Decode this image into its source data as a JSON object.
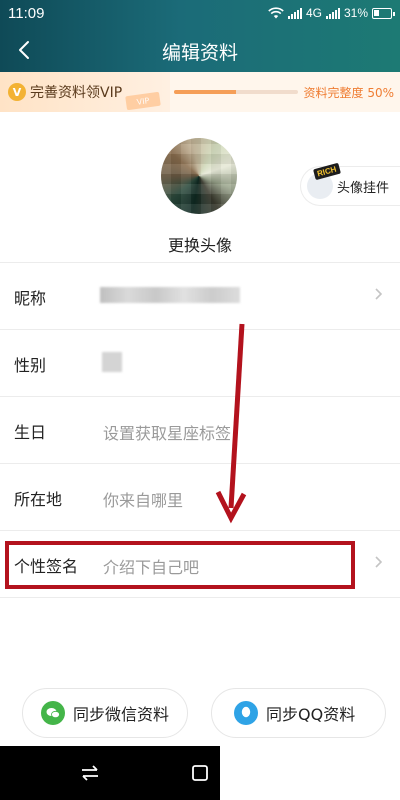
{
  "status_bar": {
    "time": "11:09",
    "network": "4G",
    "battery": "31%"
  },
  "header": {
    "title": "编辑资料",
    "back_icon": "chevron-left-icon"
  },
  "vip_banner": {
    "label": "完善资料领VIP",
    "badge": "V",
    "ticket_text": "VIP",
    "completion_text": "资料完整度 50%",
    "completion_percent": 50,
    "accent_color": "#ef7d33"
  },
  "avatar": {
    "change_label": "更换头像"
  },
  "pendant": {
    "label": "头像挂件",
    "tag": "RICH"
  },
  "form": {
    "rows": [
      {
        "label": "昵称",
        "value": ""
      },
      {
        "label": "性别",
        "value": ""
      },
      {
        "label": "生日",
        "value": "设置获取星座标签"
      },
      {
        "label": "所在地",
        "value": "你来自哪里"
      },
      {
        "label": "个性签名",
        "value": "介绍下自己吧"
      }
    ]
  },
  "sync": {
    "wechat_label": "同步微信资料",
    "qq_label": "同步QQ资料"
  },
  "annotation": {
    "highlight_color": "#b3121d"
  }
}
